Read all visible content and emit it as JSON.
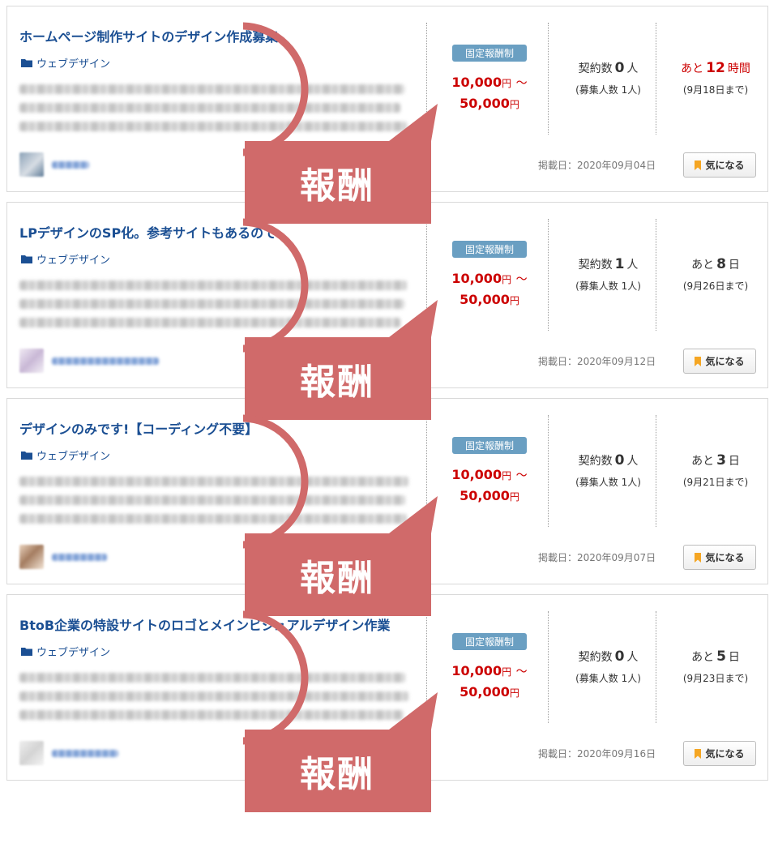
{
  "listings": [
    {
      "title": "ホームページ制作サイトのデザイン作成募集",
      "category": "ウェブデザイン",
      "price_type": "固定報酬制",
      "price_min": "10,000",
      "price_max": "50,000",
      "yen": "円",
      "tilde": "～",
      "contract_label": "契約数",
      "contract_count": "0",
      "person_unit": "人",
      "recruit_text": "(募集人数 1人)",
      "deadline_prefix": "あと",
      "deadline_value": "12",
      "deadline_unit": "時間",
      "deadline_until": "(9月18日まで)",
      "posted": "掲載日：2020年09月04日",
      "favorite_label": "気になる",
      "callout": "報酬"
    },
    {
      "title": "LPデザインのSP化。参考サイトもあるので",
      "category": "ウェブデザイン",
      "price_type": "固定報酬制",
      "price_min": "10,000",
      "price_max": "50,000",
      "yen": "円",
      "tilde": "～",
      "contract_label": "契約数",
      "contract_count": "1",
      "person_unit": "人",
      "recruit_text": "(募集人数 1人)",
      "deadline_prefix": "あと",
      "deadline_value": "8",
      "deadline_unit": "日",
      "deadline_until": "(9月26日まで)",
      "posted": "掲載日：2020年09月12日",
      "favorite_label": "気になる",
      "callout": "報酬"
    },
    {
      "title": "デザインのみです!【コーディング不要】",
      "category": "ウェブデザイン",
      "price_type": "固定報酬制",
      "price_min": "10,000",
      "price_max": "50,000",
      "yen": "円",
      "tilde": "～",
      "contract_label": "契約数",
      "contract_count": "0",
      "person_unit": "人",
      "recruit_text": "(募集人数 1人)",
      "deadline_prefix": "あと",
      "deadline_value": "3",
      "deadline_unit": "日",
      "deadline_until": "(9月21日まで)",
      "posted": "掲載日：2020年09月07日",
      "favorite_label": "気になる",
      "callout": "報酬"
    },
    {
      "title": "BtoB企業の特設サイトのロゴとメインビジュアルデザイン作業",
      "category": "ウェブデザイン",
      "price_type": "固定報酬制",
      "price_min": "10,000",
      "price_max": "50,000",
      "yen": "円",
      "tilde": "～",
      "contract_label": "契約数",
      "contract_count": "0",
      "person_unit": "人",
      "recruit_text": "(募集人数 1人)",
      "deadline_prefix": "あと",
      "deadline_value": "5",
      "deadline_unit": "日",
      "deadline_until": "(9月23日まで)",
      "posted": "掲載日：2020年09月16日",
      "favorite_label": "気になる",
      "callout": "報酬"
    }
  ],
  "colors": {
    "title": "#1b4f93",
    "price": "#cc0000",
    "badge": "#6a9fc2",
    "callout": "#d06a6a",
    "bookmark": "#f5a623"
  },
  "icons": {
    "category": "folder-icon",
    "favorite": "bookmark-icon"
  }
}
